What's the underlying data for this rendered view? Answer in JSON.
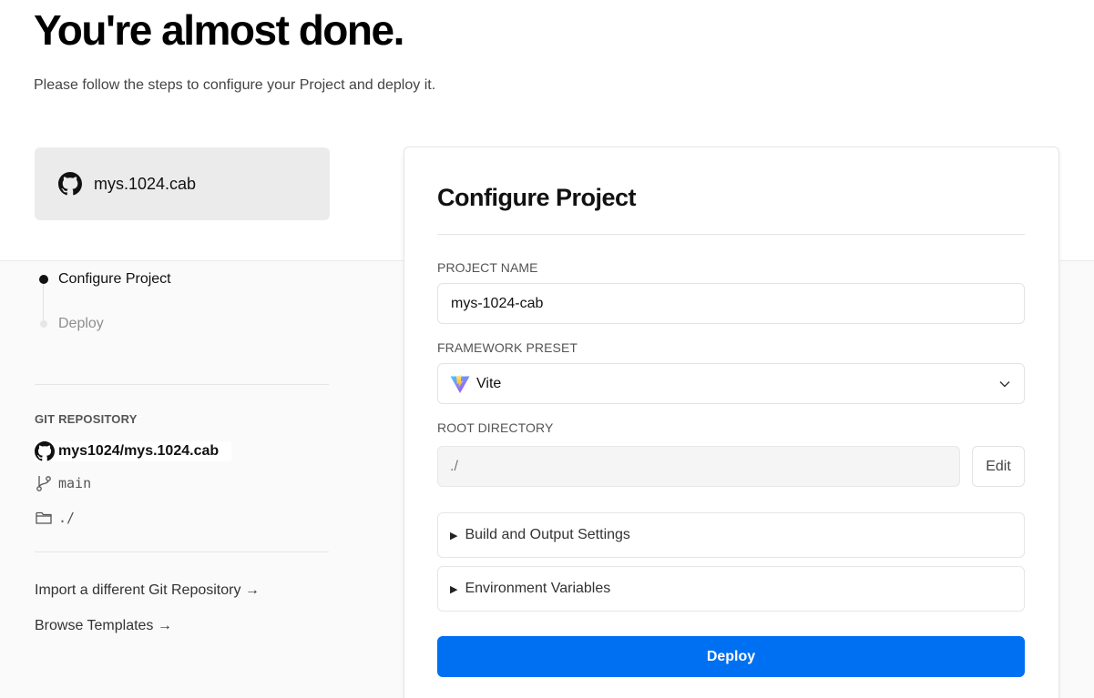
{
  "header": {
    "title": "You're almost done.",
    "subtitle": "Please follow the steps to configure your Project and deploy it."
  },
  "repo_card": {
    "name": "mys.1024.cab",
    "icon": "github-icon"
  },
  "steps": [
    {
      "label": "Configure Project",
      "active": true
    },
    {
      "label": "Deploy",
      "active": false
    }
  ],
  "git": {
    "heading": "GIT REPOSITORY",
    "repo": "mys1024/mys.1024.cab",
    "branch": "main",
    "directory": "./"
  },
  "links": {
    "import": "Import a different Git Repository →",
    "templates": "Browse Templates →"
  },
  "configure": {
    "title": "Configure Project",
    "project_name_label": "PROJECT NAME",
    "project_name_value": "mys-1024-cab",
    "framework_label": "FRAMEWORK PRESET",
    "framework_value": "Vite",
    "root_label": "ROOT DIRECTORY",
    "root_value": "./",
    "edit_label": "Edit",
    "build_settings_label": "Build and Output Settings",
    "env_vars_label": "Environment Variables",
    "deploy_label": "Deploy"
  },
  "colors": {
    "accent": "#0070f3",
    "text": "#111111",
    "muted": "#8f8f8f"
  }
}
